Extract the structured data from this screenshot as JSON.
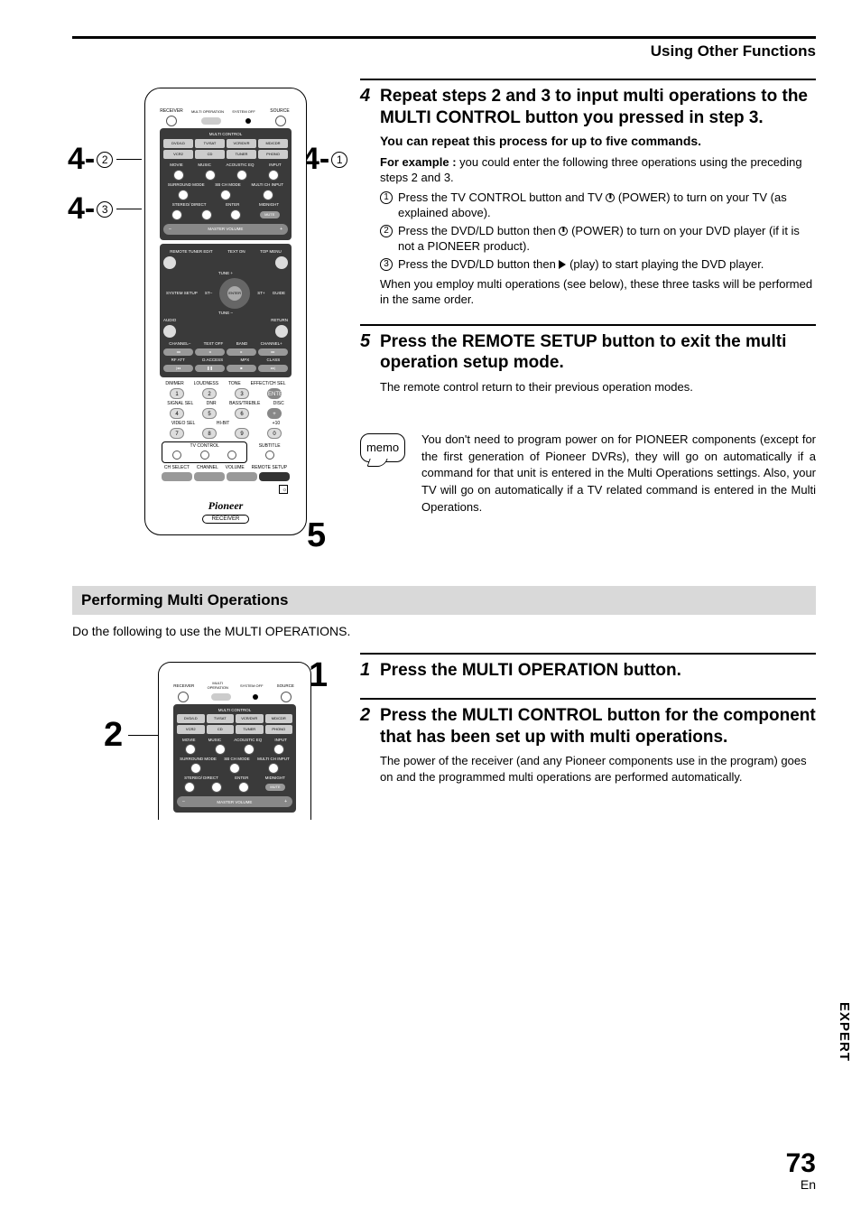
{
  "header": {
    "title": "Using Other Functions"
  },
  "callouts": {
    "c41": {
      "num": "4-",
      "sub": "1"
    },
    "c42": {
      "num": "4-",
      "sub": "2"
    },
    "c43": {
      "num": "4-",
      "sub": "3"
    },
    "c5": "5",
    "s1": "1",
    "s2": "2"
  },
  "remote": {
    "top_labels": {
      "receiver": "RECEIVER",
      "multi_op": "MULTI\nOPERATION",
      "system_off": "SYSTEM\nOFF",
      "source": "SOURCE"
    },
    "mc_label": "MULTI CONTROL",
    "mc_row1": [
      "DVD/LD",
      "TV/SAT",
      "VCR/DVR",
      "MD/CDR"
    ],
    "mc_row2": [
      "VCR2",
      "CD",
      "TUNER",
      "PHONO"
    ],
    "mode_row1": [
      "MOVIE",
      "MUSIC",
      "ACOUSTIC EQ",
      "INPUT"
    ],
    "mode_row2": [
      "SURROUND MODE",
      "SB CH MODE",
      "MULTI CH INPUT"
    ],
    "mode_row3": [
      "STEREO/ DIRECT",
      "ENTER",
      "MIDNIGHT"
    ],
    "mute": "MUTE",
    "master_vol": "MASTER VOLUME",
    "middle": {
      "remote_tuner": "REMOTE TUNER EDIT",
      "text_on": "TEXT ON",
      "top_menu": "TOP MENU",
      "tune_plus": "TUNE +",
      "tune_minus": "TUNE –",
      "system_setup": "SYSTEM SETUP",
      "st_minus": "ST–",
      "enter": "ENTER",
      "st_plus": "ST+",
      "guide": "GUIDE",
      "audio": "AUDIO",
      "return": "RETURN",
      "ch_minus": "CHANNEL–",
      "text_off": "TEXT OFF",
      "band": "BAND",
      "ch_plus": "CHANNEL+",
      "rf_att": "RF ATT",
      "daccess": "D.ACCESS",
      "mpx": "MPX",
      "class": "CLASS"
    },
    "num_labels": {
      "dimmer": "DIMMER",
      "loudness": "LOUDNESS",
      "tone": "TONE",
      "effect": "EFFECT/CH SEL",
      "signal": "SIGNAL SEL",
      "dnr": "DNR",
      "bass": "BASS/TREBLE",
      "disc": "DISC",
      "video": "VIDEO SEL",
      "hibit": "HI-BIT",
      "ten": "+10"
    },
    "nums": [
      "1",
      "2",
      "3",
      "4",
      "5",
      "6",
      "7",
      "8",
      "9",
      "0"
    ],
    "enter_small": "ENTER",
    "tv_control": "TV CONTROL",
    "subtitle": "SUBTITLE",
    "bottom": [
      "CH SELECT",
      "CHANNEL",
      "VOLUME",
      "REMOTE SETUP"
    ],
    "logo": "Pioneer",
    "label": "RECEIVER"
  },
  "steps": {
    "s4": {
      "num": "4",
      "title": "Repeat steps 2 and 3 to input multi operations to the MULTI CONTROL button you pressed in step 3.",
      "subtitle": "You can repeat this process for up to five commands.",
      "for_example_label": "For example :",
      "for_example_text": " you could enter the following three operations using the preceding steps 2 and 3.",
      "ex1_a": "Press the TV CONTROL button and TV ",
      "ex1_b": " (POWER) to turn on your TV (as explained above).",
      "ex2_a": "Press the DVD/LD button then ",
      "ex2_b": " (POWER) to turn on your DVD player (if it is not a PIONEER product).",
      "ex3_a": "Press the DVD/LD button then ",
      "ex3_b": " (play) to start playing the DVD player.",
      "tail": "When you employ multi operations (see below), these three tasks will be performed in the same order."
    },
    "s5": {
      "num": "5",
      "title": "Press the REMOTE SETUP button to exit the multi operation setup mode.",
      "body": "The remote control return to their previous operation modes."
    }
  },
  "memo": {
    "label": "memo",
    "text": "You don't need to program power on for PIONEER components (except for the first generation of Pioneer DVRs), they will go on automatically if a command for that unit is entered in the Multi Operations settings. Also, your TV will go on automatically if a TV related command is entered in the Multi Operations."
  },
  "perform": {
    "heading": "Performing Multi Operations",
    "intro": "Do the following to use the MULTI OPERATIONS.",
    "s1": {
      "num": "1",
      "title": "Press the MULTI OPERATION button."
    },
    "s2": {
      "num": "2",
      "title": "Press the MULTI CONTROL button for the component that has been set up with multi operations.",
      "body": "The power of the receiver (and any Pioneer components use in the program) goes on and the programmed multi operations are performed automatically."
    }
  },
  "side_label": "EXPERT",
  "page_number": {
    "n": "73",
    "lang": "En"
  }
}
